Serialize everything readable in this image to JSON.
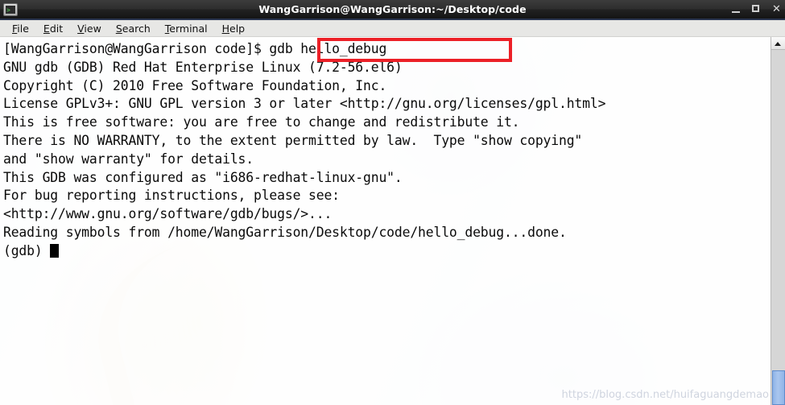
{
  "window": {
    "title": "WangGarrison@WangGarrison:~/Desktop/code",
    "icon": "terminal-icon",
    "controls": {
      "minimize": "_",
      "maximize": "□",
      "close": "✕"
    }
  },
  "menubar": {
    "items": [
      {
        "mnemonic": "F",
        "rest": "ile"
      },
      {
        "mnemonic": "E",
        "rest": "dit"
      },
      {
        "mnemonic": "V",
        "rest": "iew"
      },
      {
        "mnemonic": "S",
        "rest": "earch"
      },
      {
        "mnemonic": "T",
        "rest": "erminal"
      },
      {
        "mnemonic": "H",
        "rest": "elp"
      }
    ]
  },
  "terminal": {
    "lines": [
      "[WangGarrison@WangGarrison code]$ gdb hello_debug",
      "GNU gdb (GDB) Red Hat Enterprise Linux (7.2-56.el6)",
      "Copyright (C) 2010 Free Software Foundation, Inc.",
      "License GPLv3+: GNU GPL version 3 or later <http://gnu.org/licenses/gpl.html>",
      "This is free software: you are free to change and redistribute it.",
      "There is NO WARRANTY, to the extent permitted by law.  Type \"show copying\"",
      "and \"show warranty\" for details.",
      "This GDB was configured as \"i686-redhat-linux-gnu\".",
      "For bug reporting instructions, please see:",
      "<http://www.gnu.org/software/gdb/bugs/>...",
      "Reading symbols from /home/WangGarrison/Desktop/code/hello_debug...done."
    ],
    "prompt": "(gdb) ",
    "cursor": "block"
  },
  "annotation": {
    "highlighted_command": "gdb hello_debug",
    "color": "#ec2027"
  },
  "scrollbar": {
    "up_arrow": "scroll-up-arrow",
    "thumb_color": "#8fb4e8"
  },
  "watermark": {
    "text": "https://blog.csdn.net/huifaguangdemao"
  }
}
